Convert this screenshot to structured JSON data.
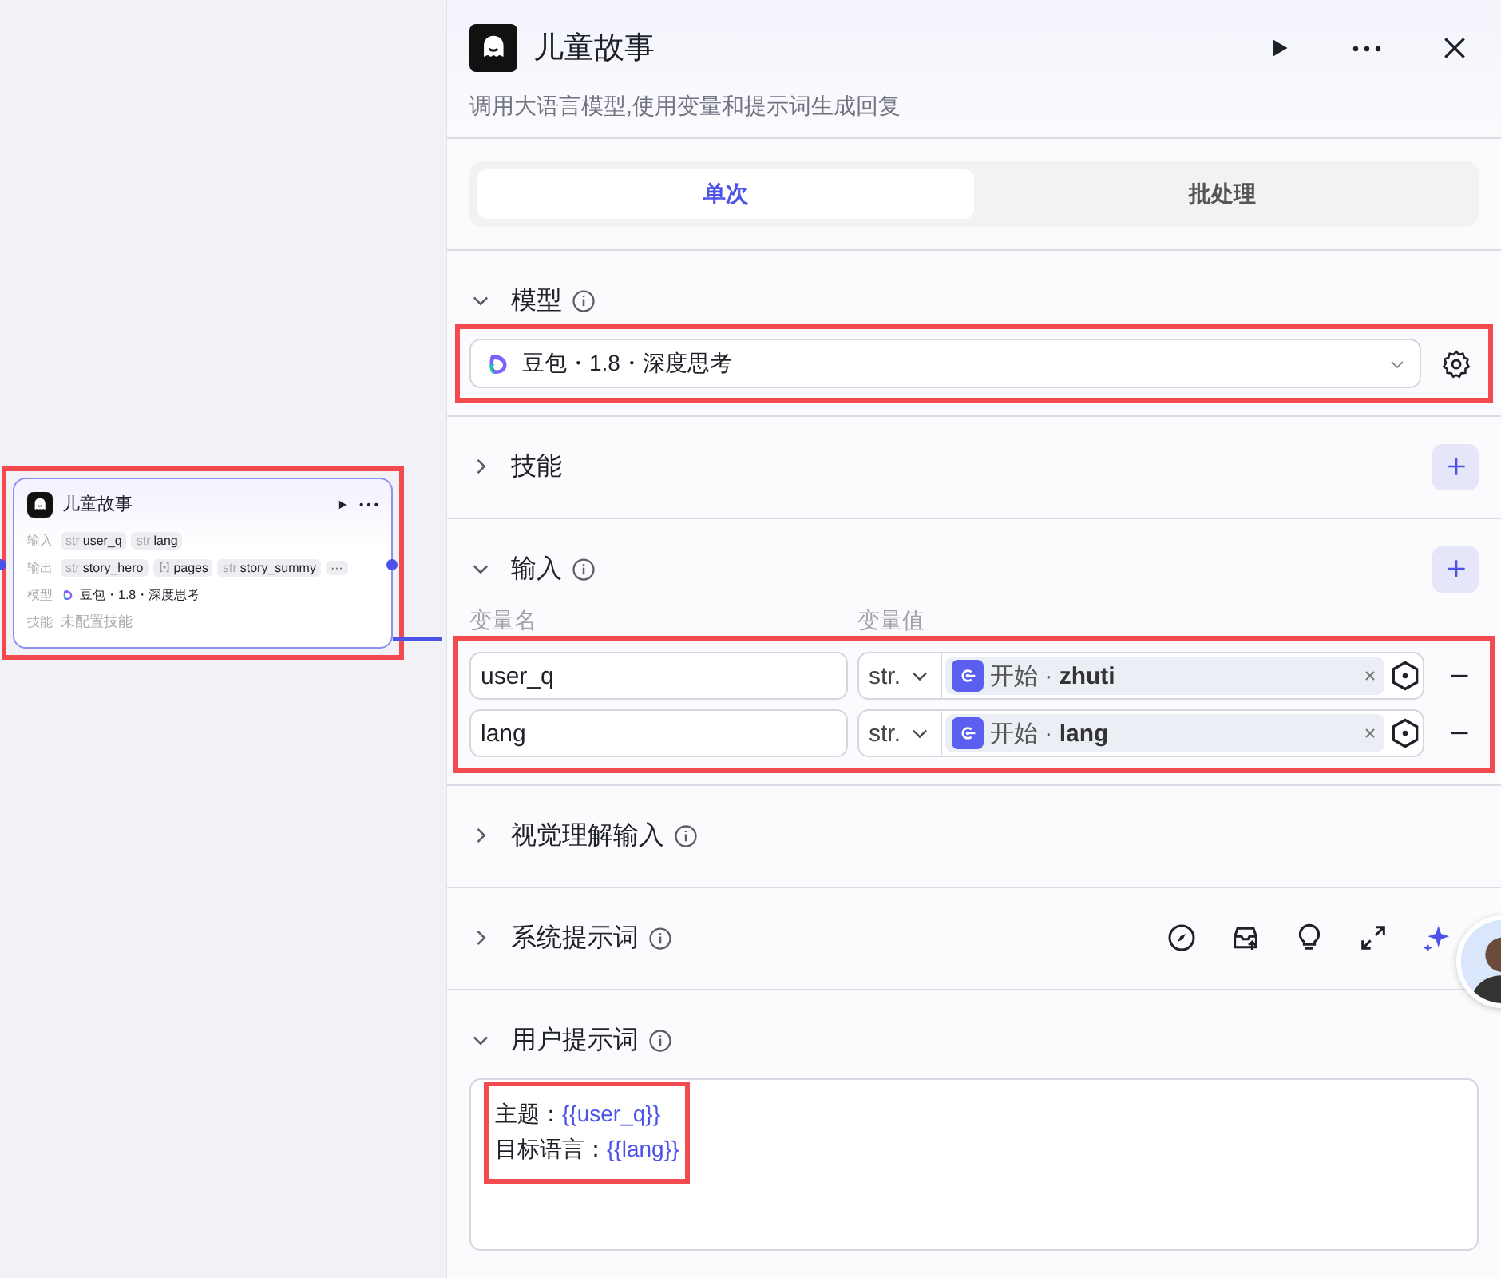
{
  "canvas": {
    "node": {
      "title": "儿童故事",
      "highlighted": true,
      "rows": [
        {
          "label": "输入",
          "kind": "tags",
          "tags": [
            {
              "kind": "text",
              "type": "str",
              "name": "user_q"
            },
            {
              "kind": "text",
              "type": "str",
              "name": "lang"
            }
          ]
        },
        {
          "label": "输出",
          "kind": "tags",
          "tags": [
            {
              "kind": "text",
              "type": "str",
              "name": "story_hero"
            },
            {
              "kind": "array",
              "name": "pages"
            },
            {
              "kind": "text",
              "type": "str",
              "name": "story_summy"
            }
          ],
          "more": "···"
        },
        {
          "label": "模型",
          "kind": "model",
          "value": "豆包・1.8・深度思考"
        },
        {
          "label": "技能",
          "kind": "empty",
          "value": "未配置技能"
        }
      ]
    }
  },
  "panel": {
    "title": "儿童故事",
    "description": "调用大语言模型,使用变量和提示词生成回复",
    "tabs": [
      {
        "label": "单次",
        "selected": true
      },
      {
        "label": "批处理",
        "selected": false
      }
    ],
    "sections": [
      {
        "kind": "model",
        "title": "模型",
        "expanded": true,
        "info": true,
        "add": false,
        "highlighted": true,
        "model": "豆包・1.8・深度思考"
      },
      {
        "kind": "skills",
        "title": "技能",
        "expanded": false,
        "info": false,
        "add": true
      },
      {
        "kind": "inputs",
        "title": "输入",
        "expanded": true,
        "info": true,
        "add": true,
        "highlighted": true,
        "columns": [
          "变量名",
          "变量值"
        ],
        "rows": [
          {
            "name": "user_q",
            "type": "str.",
            "reference": "开始 · **zhuti**"
          },
          {
            "name": "lang",
            "type": "str.",
            "reference": "开始 · **lang**"
          }
        ]
      },
      {
        "kind": "vision",
        "title": "视觉理解输入",
        "expanded": false,
        "info": true,
        "add": false
      },
      {
        "kind": "system",
        "title": "系统提示词",
        "expanded": false,
        "info": true,
        "add": false
      },
      {
        "kind": "user",
        "title": "用户提示词",
        "expanded": true,
        "info": true,
        "add": false,
        "highlighted": true,
        "lines": [
          {
            "text": "主题：",
            "var": "{{user_q}}"
          },
          {
            "text": "目标语言：",
            "var": "{{lang}}"
          }
        ]
      }
    ]
  }
}
